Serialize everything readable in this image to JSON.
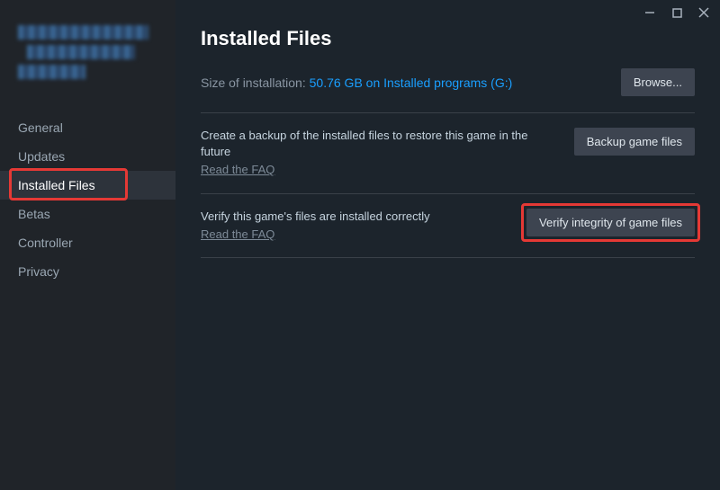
{
  "header": {
    "title": "Installed Files"
  },
  "sidebar": {
    "items": [
      {
        "label": "General"
      },
      {
        "label": "Updates"
      },
      {
        "label": "Installed Files"
      },
      {
        "label": "Betas"
      },
      {
        "label": "Controller"
      },
      {
        "label": "Privacy"
      }
    ]
  },
  "size_section": {
    "prefix": "Size of installation: ",
    "link_text": "50.76 GB on Installed programs (G:)",
    "browse_label": "Browse..."
  },
  "backup_section": {
    "desc": "Create a backup of the installed files to restore this game in the future",
    "faq": "Read the FAQ",
    "button": "Backup game files"
  },
  "verify_section": {
    "desc": "Verify this game's files are installed correctly",
    "faq": "Read the FAQ",
    "button": "Verify integrity of game files"
  }
}
